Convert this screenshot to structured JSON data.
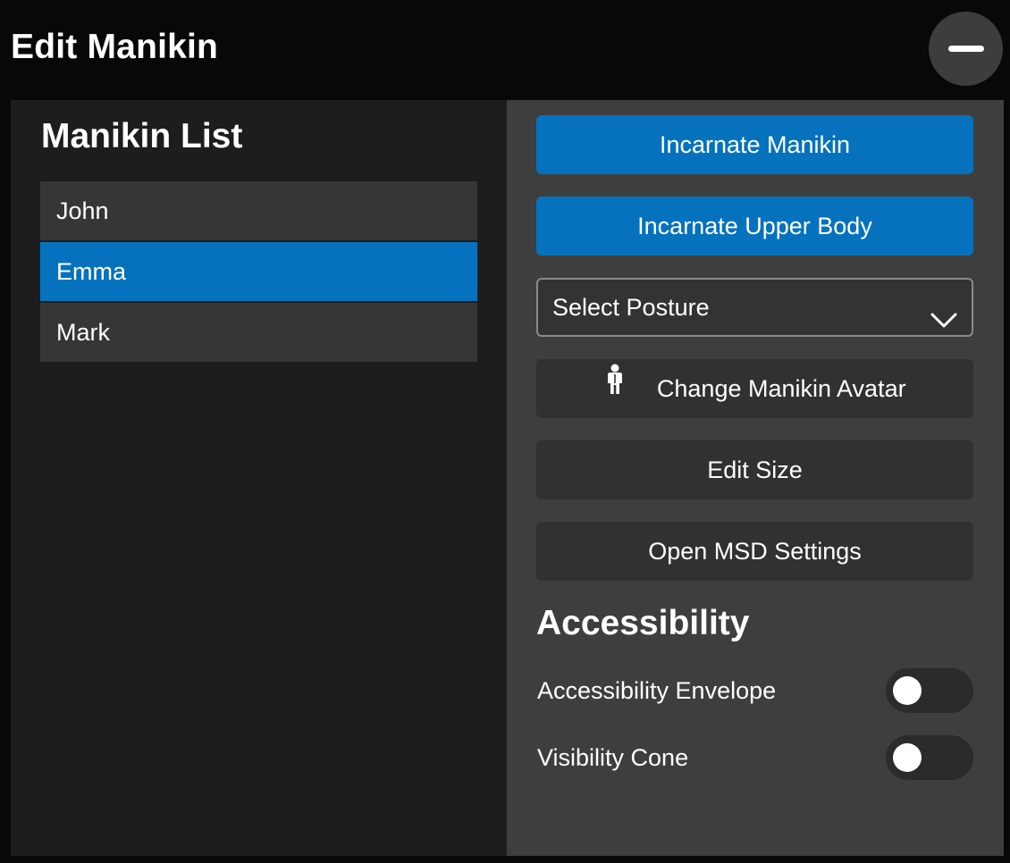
{
  "window": {
    "title": "Edit Manikin"
  },
  "manikin_list": {
    "title": "Manikin List",
    "items": [
      {
        "label": "John",
        "selected": false
      },
      {
        "label": "Emma",
        "selected": true
      },
      {
        "label": "Mark",
        "selected": false
      }
    ]
  },
  "actions": {
    "incarnate_manikin": "Incarnate Manikin",
    "incarnate_upper_body": "Incarnate Upper Body",
    "posture_select": {
      "value": "Select Posture",
      "icon": "chevron-down-icon"
    },
    "change_avatar": {
      "label": "Change Manikin Avatar",
      "icon": "person-icon"
    },
    "edit_size": "Edit Size",
    "open_msd_settings": "Open MSD Settings"
  },
  "accessibility": {
    "title": "Accessibility",
    "toggles": [
      {
        "label": "Accessibility Envelope",
        "on": false
      },
      {
        "label": "Visibility Cone",
        "on": false
      }
    ]
  },
  "colors": {
    "accent": "#0672bd",
    "background": "#080808",
    "left_panel": "#1d1d1d",
    "right_panel": "#3e3e3e"
  }
}
